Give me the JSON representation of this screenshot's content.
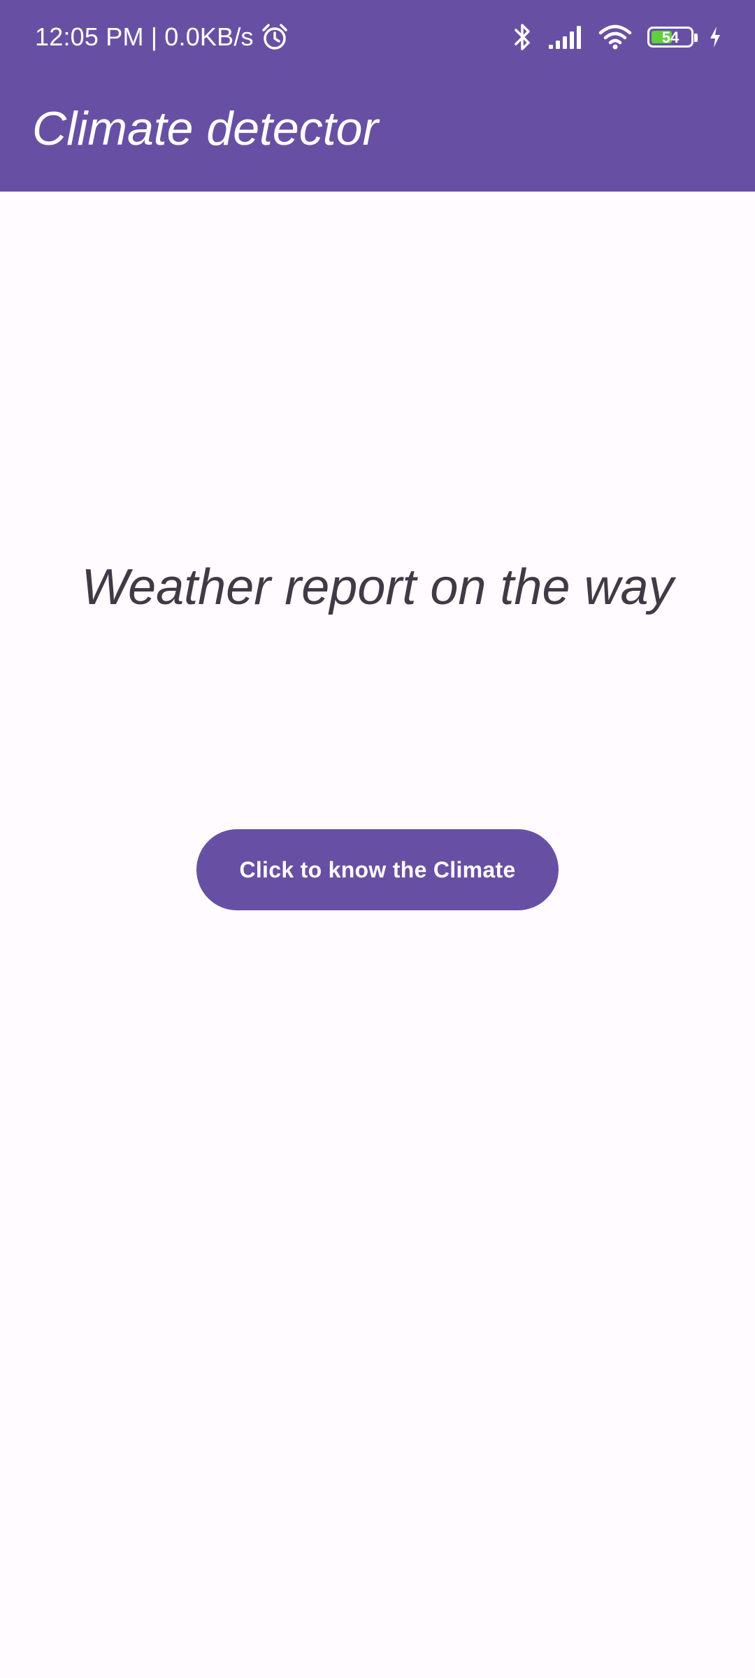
{
  "status_bar": {
    "time": "12:05 PM",
    "separator": "|",
    "net_speed": "0.0KB/s",
    "battery_level": "54",
    "battery_fraction": 0.54,
    "icons": [
      "alarm-icon",
      "bluetooth-icon",
      "signal-icon",
      "wifi-icon",
      "battery-icon",
      "charging-bolt-icon"
    ]
  },
  "app_bar": {
    "title": "Climate detector"
  },
  "main": {
    "headline": "Weather report on the way",
    "button_label": "Click to know the Climate"
  },
  "colors": {
    "primary": "#6750a4",
    "background": "#fffbfe",
    "headline_text": "#3f3a46",
    "battery_fill": "#5fcf3c"
  }
}
